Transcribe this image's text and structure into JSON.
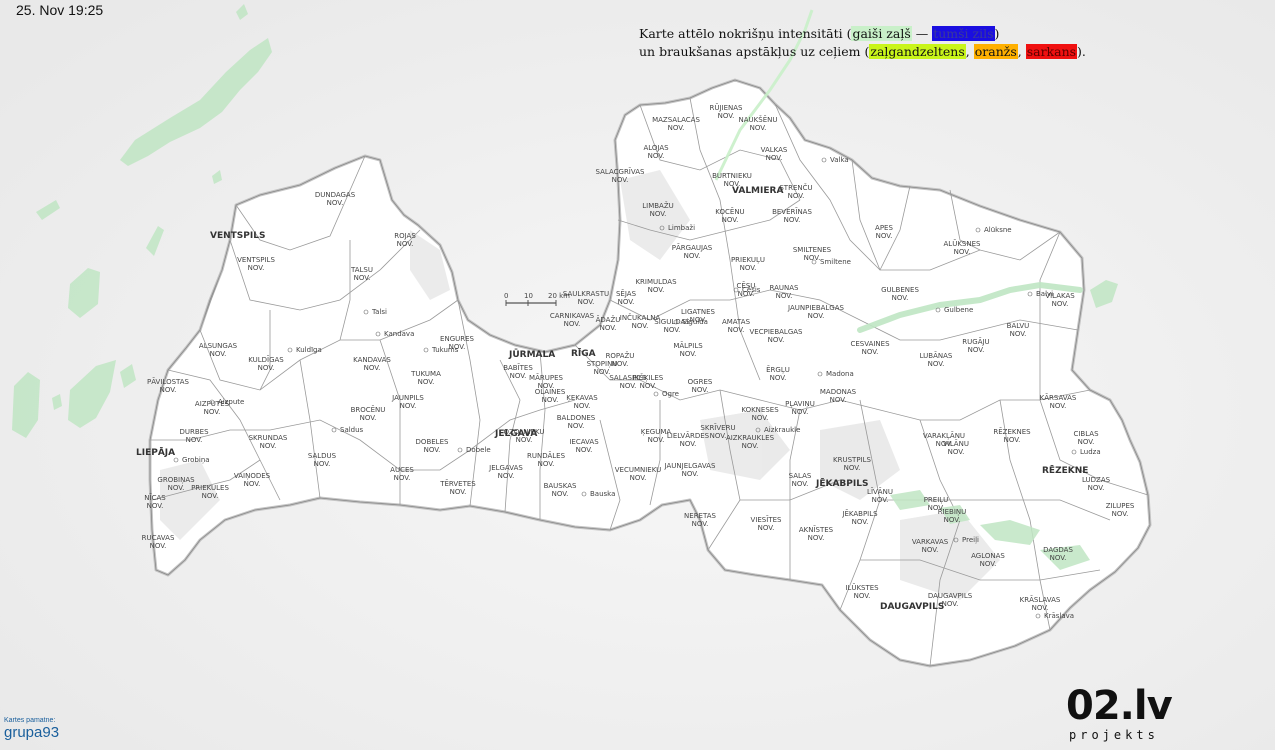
{
  "timestamp": "25. Nov 19:25",
  "legend": {
    "line1_prefix": "Karte attēlo nokrišņu intensitāti (",
    "light_green": "gaiši zaļš",
    "dash": " — ",
    "dark_blue": "tumši zils",
    "line1_suffix": ")",
    "line2_prefix": "un braukšanas apstākļus uz ceļiem (",
    "yellow_green": "zaļgandzeltens",
    "sep1": ", ",
    "orange": "oranžs",
    "sep2": ", ",
    "red": "sarkans",
    "line2_suffix": ")."
  },
  "colors": {
    "light_green": "#c9f0c9",
    "dark_blue": "#1a0ee0",
    "yellow_green": "#c9f51a",
    "orange": "#ffb000",
    "red": "#f01010",
    "rain": "#bfe5c3"
  },
  "scale_bar": {
    "labels": [
      "0",
      "10",
      "20 km"
    ]
  },
  "credit": {
    "caption": "Kartes pamatne:",
    "name": "grupa93"
  },
  "logo": {
    "main": "02.lv",
    "sub": "projekts"
  },
  "cities": [
    "VENTSPILS",
    "LIEPĀJA",
    "JŪRMALA",
    "RĪGA",
    "JELGAVA",
    "VALMIERA",
    "JĒKABPILS",
    "DAUGAVPILS",
    "RĒZEKNE"
  ],
  "municipalities": [
    "DUNDAGAS NOV.",
    "ROJAS NOV.",
    "VENTSPILS NOV.",
    "TALSU NOV.",
    "ENGURES NOV.",
    "TUKUMA NOV.",
    "KULDĪGAS NOV.",
    "ALSUNGAS NOV.",
    "PĀVILOSTAS NOV.",
    "AIZPUTES NOV.",
    "DURBES NOV.",
    "GROBIŅAS NOV.",
    "PRIEKULES NOV.",
    "VAIŅODES NOV.",
    "NĪCAS NOV.",
    "RUCAVAS NOV.",
    "SKRUNDAS NOV.",
    "SALDUS NOV.",
    "BROCĒNU NOV.",
    "KANDAVAS NOV.",
    "AUCES NOV.",
    "DOBELES NOV.",
    "TĒRVETES NOV.",
    "JAUNPILS NOV.",
    "OZOLNIEKU NOV.",
    "JELGAVAS NOV.",
    "BAUSKAS NOV.",
    "IECAVAS NOV.",
    "VECUMNIEKU NOV.",
    "RUNDĀLES NOV.",
    "OLAINES NOV.",
    "BABĪTES NOV.",
    "MĀRUPES NOV.",
    "ĶEKAVAS NOV.",
    "BALDONES NOV.",
    "ĶEGUMA NOV.",
    "OGRES NOV.",
    "IKŠĶILES NOV.",
    "ROPAŽU NOV.",
    "STOPIŅU NOV.",
    "SALASPILS NOV.",
    "CARNIKAVAS NOV.",
    "ĀDAŽU NOV.",
    "SAULKRASTU NOV.",
    "SĒJAS NOV.",
    "INČUKALNA NOV.",
    "KRIMULDAS NOV.",
    "SIGULDAS NOV.",
    "MĀLPILS NOV.",
    "LIGATNES NOV.",
    "AMATAS NOV.",
    "CĒSU NOV.",
    "PRIEKUĻU NOV.",
    "PĀRGAUJAS NOV.",
    "LIMBAŽU NOV.",
    "SALACGRĪVAS NOV.",
    "ALOJAS NOV.",
    "MAZSALACAS NOV.",
    "RŪJIENAS NOV.",
    "NAUKŠĒNU NOV.",
    "BURTNIEKU NOV.",
    "KOCĒNU NOV.",
    "BEVERĪNAS NOV.",
    "STRENČU NOV.",
    "VALKAS NOV.",
    "SMILTENES NOV.",
    "APES NOV.",
    "ALŪKSNES NOV.",
    "GULBENES NOV.",
    "BALVU NOV.",
    "VILAKAS NOV.",
    "RUGĀJU NOV.",
    "LUBĀNAS NOV.",
    "CESVAINES NOV.",
    "MADONAS NOV.",
    "ĒRGĻU NOV.",
    "VECPIEBALGAS NOV.",
    "JAUNPIEBALGAS NOV.",
    "RAUNAS NOV.",
    "LIELVĀRDES NOV.",
    "SKRĪVERU NOV.",
    "AIZKRAUKLES NOV.",
    "KOKNESES NOV.",
    "PĻAVIŅU NOV.",
    "JAUNJELGAVAS NOV.",
    "NERETAS NOV.",
    "VIESĪTES NOV.",
    "SALAS NOV.",
    "KRUSTPILS NOV.",
    "JĒKABPILS NOV.",
    "VARAKĻĀNU NOV.",
    "VILĀNU NOV.",
    "RĒZEKNES NOV.",
    "KĀRSAVAS NOV.",
    "CIBLAS NOV.",
    "LUDZAS NOV.",
    "ZILUPES NOV.",
    "DAGDAS NOV.",
    "AGLONAS NOV.",
    "RIEBIŅU NOV.",
    "PREIĻU NOV.",
    "LĪVĀNU NOV.",
    "VARKAVAS NOV.",
    "ILŪKSTES NOV.",
    "DAUGAVPILS NOV.",
    "KRĀSLAVAS NOV.",
    "AKNĪSTES NOV."
  ],
  "towns": [
    "Kuldīga",
    "Talsi",
    "Tukums",
    "Saldus",
    "Dobele",
    "Bauska",
    "Ogre",
    "Cēsis",
    "Sigulda",
    "Limbaži",
    "Valka",
    "Smiltene",
    "Alūksne",
    "Gulbene",
    "Balvi",
    "Madona",
    "Ludza",
    "Krāslava",
    "Preiļi",
    "Aizkraukle",
    "Grobiņa",
    "Aizpute",
    "Kandava"
  ]
}
